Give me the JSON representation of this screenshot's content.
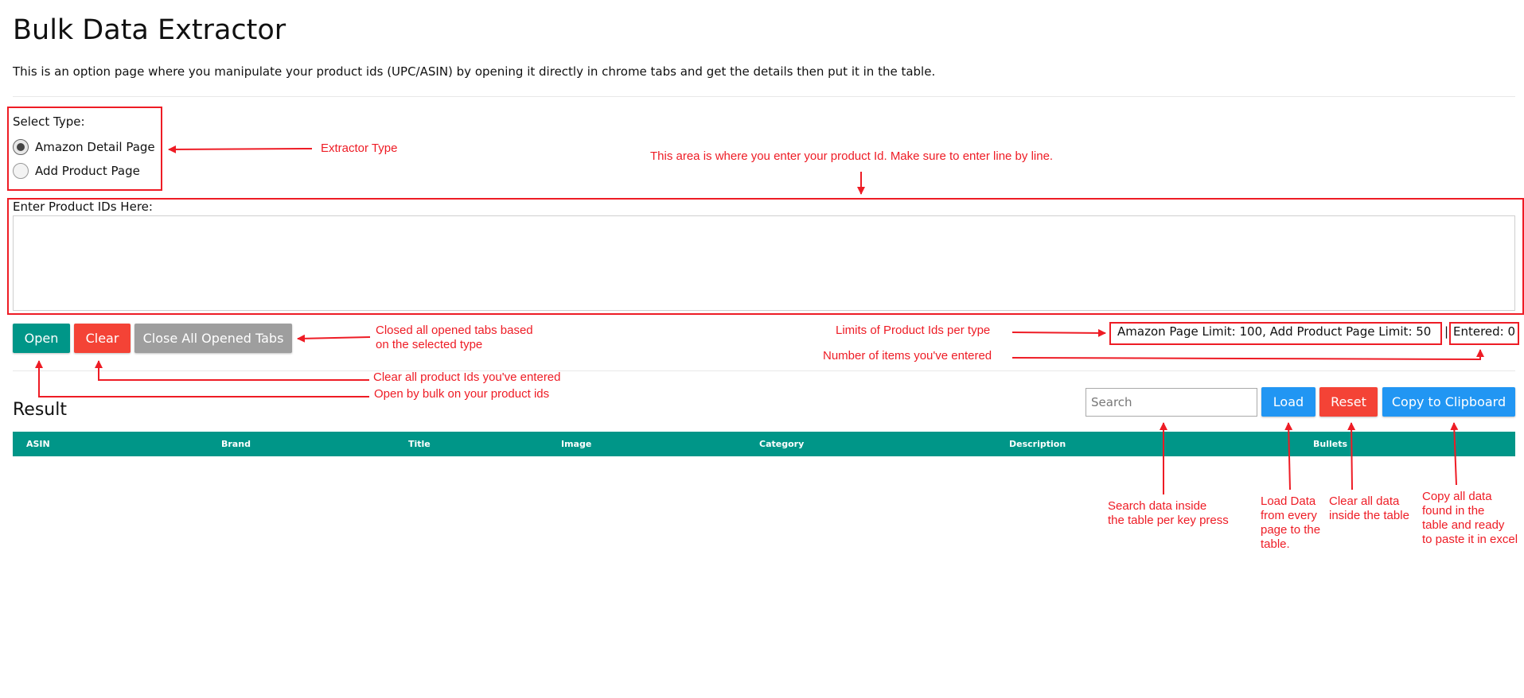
{
  "header": {
    "title": "Bulk Data Extractor",
    "description": "This is an option page where you manipulate your product ids (UPC/ASIN) by opening it directly in chrome tabs and get the details then put it in the table."
  },
  "type_select": {
    "label": "Select Type:",
    "options": [
      {
        "label": "Amazon Detail Page",
        "checked": true
      },
      {
        "label": "Add Product Page",
        "checked": false
      }
    ]
  },
  "product_ids": {
    "label": "Enter Product IDs Here:",
    "value": ""
  },
  "actions": {
    "open_label": "Open",
    "clear_label": "Clear",
    "close_tabs_label": "Close All Opened Tabs"
  },
  "limits": {
    "text": "Amazon Page Limit: 100, Add Product Page Limit: 50",
    "separator": "|",
    "entered_text": "Entered: 0"
  },
  "result": {
    "title": "Result",
    "search_placeholder": "Search",
    "load_label": "Load",
    "reset_label": "Reset",
    "copy_label": "Copy to Clipboard",
    "columns": [
      "ASIN",
      "Brand",
      "Title",
      "Image",
      "Category",
      "Description",
      "Bullets"
    ]
  },
  "annotations": {
    "extractor_type": "Extractor Type",
    "enter_area": "This area is where you enter your product Id. Make sure to enter line by line.",
    "close_tabs_line1": "Closed all opened tabs based",
    "close_tabs_line2": "on the selected type",
    "clear_ids": "Clear all product Ids you've entered",
    "open_bulk": "Open by bulk on your product ids",
    "limits": "Limits of Product Ids per type",
    "entered": "Number of items you've entered",
    "search_line1": "Search data inside",
    "search_line2": "the table per key press",
    "load_line1": "Load Data",
    "load_line2": "from every",
    "load_line3": "page to the",
    "load_line4": "table.",
    "reset_line1": "Clear all data",
    "reset_line2": "inside the table",
    "copy_line1": "Copy all data",
    "copy_line2": "found in the",
    "copy_line3": "table and ready",
    "copy_line4": "to paste it in excel"
  },
  "colors": {
    "teal": "#009688",
    "red": "#f44336",
    "gray": "#9e9e9e",
    "blue": "#2196f3",
    "annotation_red": "#ee1c25"
  }
}
